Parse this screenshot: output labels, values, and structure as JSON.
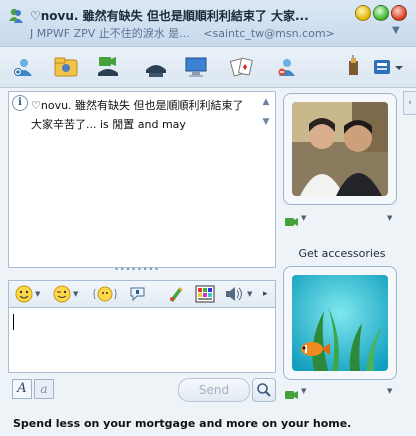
{
  "window": {
    "title": "♡novu. 雖然有缺失 但也是順順利利結束了 大家...",
    "subtitle": "J MPWF ZPV 止不住的淚水 是...",
    "contact_email": "<saintc_tw@msn.com>"
  },
  "toolbar": {
    "icons": [
      "invite-contact-icon",
      "send-files-icon",
      "video-call-icon",
      "phone-call-icon",
      "remote-assistance-icon",
      "games-icon",
      "block-contact-icon",
      "activities-icon",
      "menu-icon"
    ]
  },
  "conversation": {
    "message": "♡novu. 雖然有缺失 但也是順順利利結束了 大家辛苦了... is 閒置 and may"
  },
  "format_bar": {
    "icons": [
      "emoticon-icon",
      "wink-icon",
      "nudge-icon",
      "voice-clip-icon",
      "ink-icon",
      "background-icon",
      "sound-icon",
      "more-icon"
    ]
  },
  "input": {
    "value": ""
  },
  "actions": {
    "send_label": "Send"
  },
  "right_panel": {
    "get_accessories_label": "Get accessories"
  },
  "ad": {
    "text": "Spend less on your mortgage and more on your home."
  },
  "colors": {
    "window_bg": "#eef3f8",
    "border": "#a9bdd4",
    "title_text": "#1c2a3a",
    "subtitle_text": "#5a7394"
  }
}
